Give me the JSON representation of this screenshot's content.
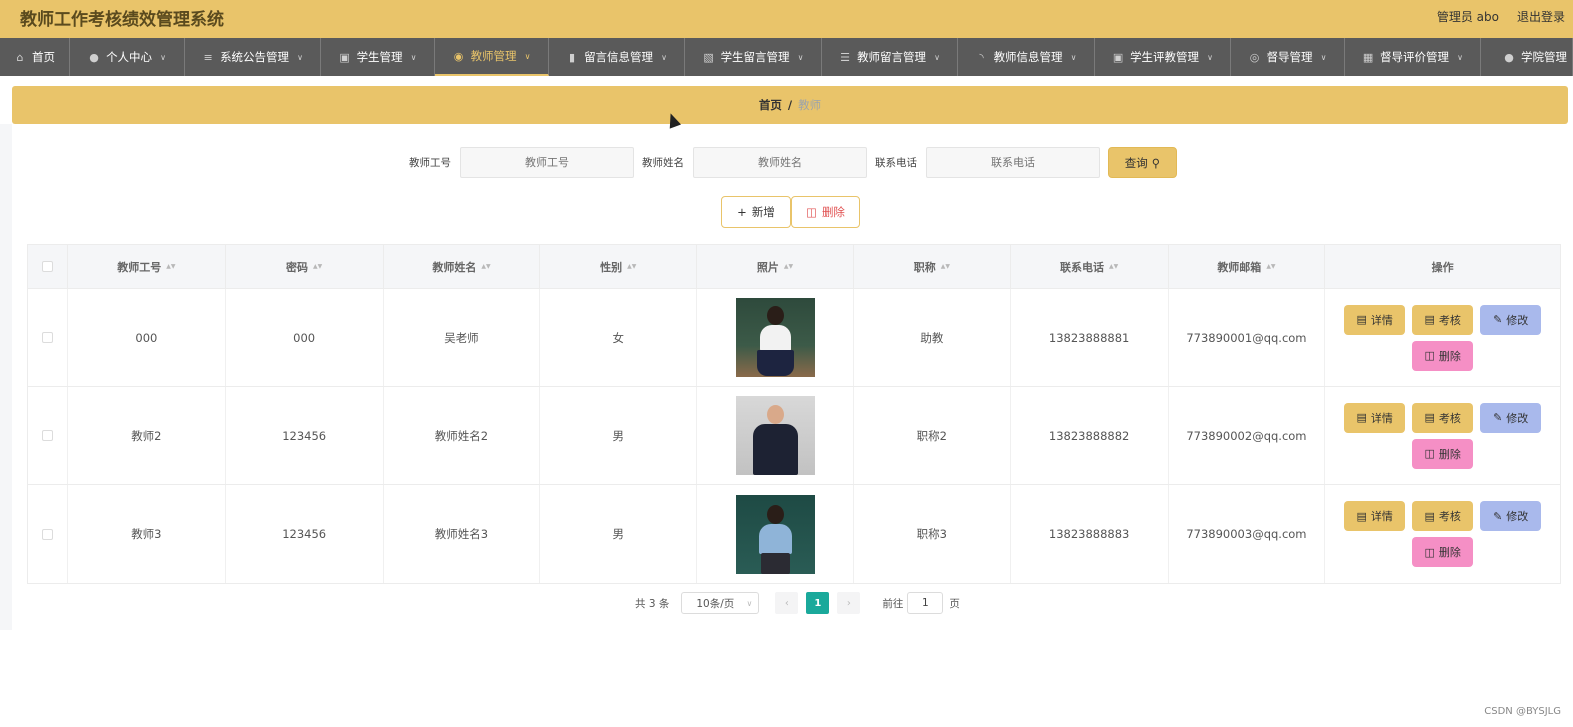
{
  "header": {
    "title": "教师工作考核绩效管理系统",
    "user_label": "管理员 abo",
    "logout": "退出登录"
  },
  "nav": [
    {
      "label": "首页",
      "icon": "home-icon"
    },
    {
      "label": "个人中心",
      "icon": "user-icon"
    },
    {
      "label": "系统公告管理",
      "icon": "sliders-icon"
    },
    {
      "label": "学生管理",
      "icon": "chat-icon"
    },
    {
      "label": "教师管理",
      "icon": "location-icon",
      "active": true
    },
    {
      "label": "留言信息管理",
      "icon": "bar-chart-icon"
    },
    {
      "label": "学生留言管理",
      "icon": "clipboard-icon"
    },
    {
      "label": "教师留言管理",
      "icon": "list-icon"
    },
    {
      "label": "教师信息管理",
      "icon": "loading-icon"
    },
    {
      "label": "学生评教管理",
      "icon": "message-icon"
    },
    {
      "label": "督导管理",
      "icon": "ring-icon"
    },
    {
      "label": "督导评价管理",
      "icon": "wallet-icon"
    },
    {
      "label": "学院管理",
      "icon": "person-icon"
    }
  ],
  "breadcrumb": {
    "home": "首页",
    "separator": "/",
    "current": "教师"
  },
  "search": {
    "teacher_id_label": "教师工号",
    "teacher_id_placeholder": "教师工号",
    "teacher_name_label": "教师姓名",
    "teacher_name_placeholder": "教师姓名",
    "phone_label": "联系电话",
    "phone_placeholder": "联系电话",
    "query_label": "查询"
  },
  "ops": {
    "add_label": "新增",
    "delete_label": "删除"
  },
  "table": {
    "columns": [
      "教师工号",
      "密码",
      "教师姓名",
      "性别",
      "照片",
      "职称",
      "联系电话",
      "教师邮箱",
      "操作"
    ],
    "rows": [
      {
        "id": "000",
        "password": "000",
        "name": "吴老师",
        "gender": "女",
        "title": "助教",
        "phone": "13823888881",
        "email": "773890001@qq.com"
      },
      {
        "id": "教师2",
        "password": "123456",
        "name": "教师姓名2",
        "gender": "男",
        "title": "职称2",
        "phone": "13823888882",
        "email": "773890002@qq.com"
      },
      {
        "id": "教师3",
        "password": "123456",
        "name": "教师姓名3",
        "gender": "男",
        "title": "职称3",
        "phone": "13823888883",
        "email": "773890003@qq.com"
      }
    ],
    "actions": {
      "detail": "详情",
      "assess": "考核",
      "edit": "修改",
      "delete": "删除"
    }
  },
  "pagination": {
    "total": "共 3 条",
    "page_size": "10条/页",
    "current_page": "1",
    "goto_label": "前往",
    "goto_value": "1",
    "page_suffix": "页"
  },
  "watermark": "CSDN @BYSJLG",
  "colors": {
    "accent": "#e9c46a",
    "nav_bg": "#5a5a5a",
    "edit_button": "#a9b9ec",
    "delete_button": "#f58fc5",
    "current_page": "#1aa99b"
  }
}
